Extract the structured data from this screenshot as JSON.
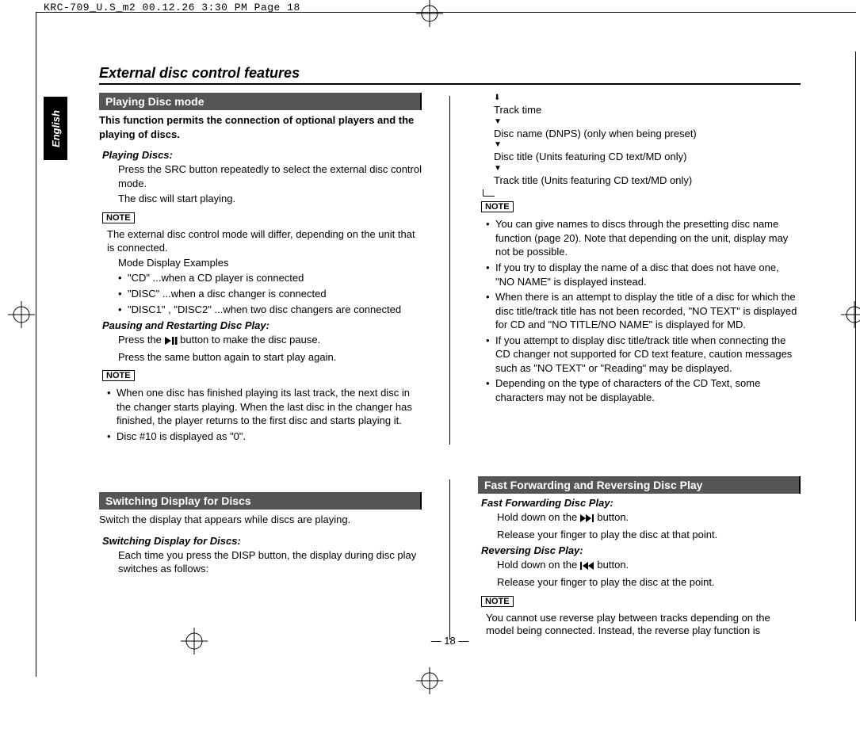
{
  "header_slug": "KRC-709_U.S_m2  00.12.26 3:30 PM  Page 18",
  "side_tab": "English",
  "section_title": "External disc control features",
  "page_number": "— 18 —",
  "playing_disc": {
    "header": "Playing Disc mode",
    "intro": "This function permits the connection of optional players and the playing of discs.",
    "playing_title": "Playing Discs:",
    "playing_step1": "Press the SRC button repeatedly to select the external disc control mode.",
    "playing_step2": "The disc will start playing.",
    "note1_label": "NOTE",
    "note1_text": "The external disc control mode will differ, depending on the unit that is connected.",
    "note1_sub": "Mode Display Examples",
    "note1_bullets": [
      "\"CD\" ...when a CD player is connected",
      "\"DISC\" ...when a disc changer is connected",
      "\"DISC1\" , \"DISC2\" ...when two disc changers are connected"
    ],
    "pausing_title": "Pausing and Restarting Disc Play:",
    "pausing_step1a": "Press the ",
    "pausing_step1b": " button to make the disc pause.",
    "pausing_step2": "Press the same button again to start play again.",
    "note2_label": "NOTE",
    "note2_bullets": [
      "When one disc has finished playing its last track, the next disc in the changer starts playing. When the last disc in the changer has finished, the player returns to the first disc and starts playing it.",
      "Disc #10 is displayed as \"0\"."
    ]
  },
  "flow_items": {
    "item1": "Track time",
    "item2": "Disc name (DNPS) (only when being preset)",
    "item3": "Disc title (Units featuring CD text/MD only)",
    "item4": "Track title (Units featuring CD text/MD only)"
  },
  "right_notes": {
    "label": "NOTE",
    "bullets": [
      "You can give names to discs through the presetting disc name function (page 20). Note that depending on the unit, display may not be possible.",
      "If you try to display the name of a disc that does not have one, \"NO NAME\" is displayed instead.",
      "When there is an attempt to display the title of a disc for which the disc title/track title has not been recorded, \"NO TEXT\" is displayed for CD and \"NO TITLE/NO NAME\" is displayed for MD.",
      "If you attempt to display disc title/track title when connecting the CD changer not supported for CD text feature, caution messages such as \"NO TEXT\" or \"Reading\" may be displayed.",
      "Depending on the type of characters of the CD Text, some characters may not be displayable."
    ]
  },
  "switching": {
    "header": "Switching Display for Discs",
    "intro": "Switch the display that appears while discs are playing.",
    "sub_title": "Switching Display for Discs:",
    "step": "Each time you press the DISP button, the display during disc play switches as follows:"
  },
  "fast": {
    "header": "Fast Forwarding and Reversing Disc Play",
    "ff_title": "Fast Forwarding Disc Play:",
    "ff_step1a": "Hold down on the ",
    "ff_step1b": " button.",
    "ff_step2": "Release your finger to play the disc at that point.",
    "rev_title": "Reversing Disc Play:",
    "rev_step1a": "Hold down on the ",
    "rev_step1b": " button.",
    "rev_step2": "Release your finger to play the disc at the point.",
    "note_label": "NOTE",
    "note_text": "You cannot use reverse play between tracks depending on the model being connected. Instead, the reverse play function is"
  }
}
